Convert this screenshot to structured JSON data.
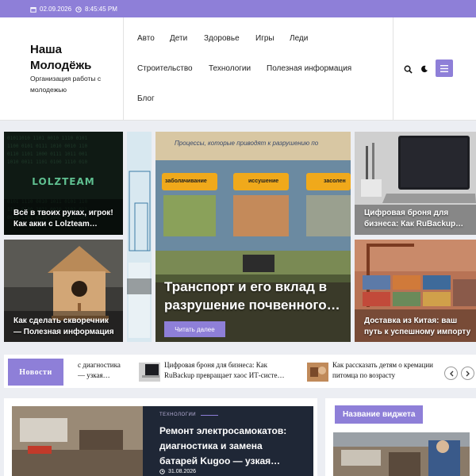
{
  "topbar": {
    "date": "02.09.2026",
    "time": "8:45:45 PM"
  },
  "header": {
    "site_title": "Наша Молодёжь",
    "site_description": "Организация работы с молодежью",
    "nav": [
      "Авто",
      "Дети",
      "Здоровье",
      "Игры",
      "Леди",
      "Строительство",
      "Технологии",
      "Полезная информация",
      "Блог"
    ]
  },
  "slider": {
    "cards": [
      {
        "title": "Всё в твоих руках, игрок! Как акки с Lolzteam…",
        "logo_text": "LOLZTEAM"
      },
      {
        "title": "Как сделать скворечник — Полезная информация"
      },
      {
        "title": "Транспорт и его вклад в разрушение почвенного…",
        "button": "Читать далее",
        "image_banner": "Процессы, которые приводят к разрушению по",
        "image_tags": [
          "заболачивание",
          "иссушение",
          "засолен"
        ]
      },
      {
        "title": "Цифровая броня для бизнеса: Как RuBackup…"
      },
      {
        "title": "Доставка из Китая: ваш путь к успешному импорту"
      }
    ]
  },
  "ticker": {
    "label": "Новости",
    "items": [
      {
        "line1": "с диагностика",
        "line2": "— узкая…"
      },
      {
        "line1": "Цифровая броня для бизнеса: Как",
        "line2": "RuBackup превращает хаос ИТ-систе…"
      },
      {
        "line1": "Как рассказать детям о кремации",
        "line2": "питомца по возрасту"
      }
    ]
  },
  "featured": {
    "category": "ТЕХНОЛОГИИ",
    "title": "Ремонт электросамокатов: диагностика и замена батарей Kugoo — узкая…",
    "date": "31.08.2026"
  },
  "widget": {
    "title": "Название виджета"
  },
  "colors": {
    "accent": "#8e7fd8"
  }
}
